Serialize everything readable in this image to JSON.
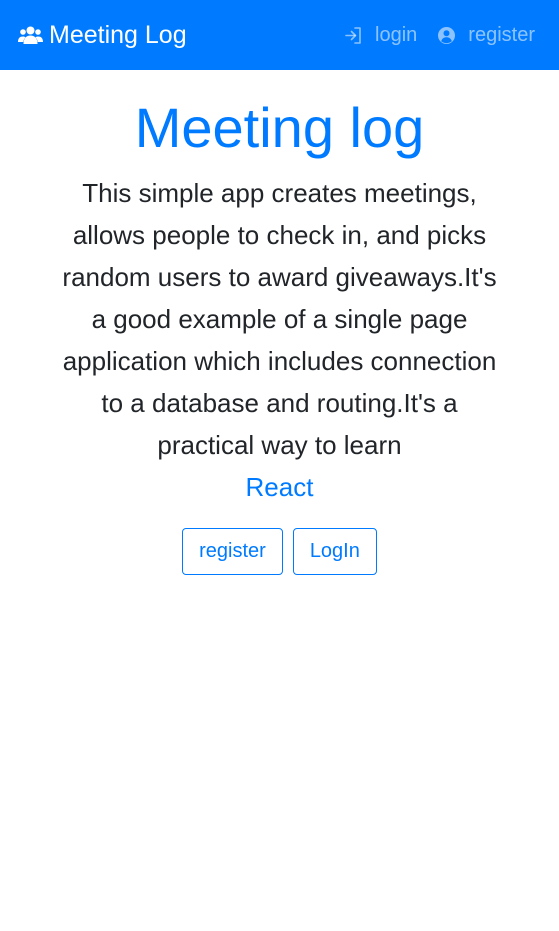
{
  "navbar": {
    "brand_label": "Meeting Log",
    "brand_icon": "users-icon",
    "links": [
      {
        "label": "login",
        "icon": "sign-in-icon"
      },
      {
        "label": "register",
        "icon": "user-circle-icon"
      }
    ],
    "background_color": "#007bff"
  },
  "hero": {
    "title": "Meeting log",
    "text": "This simple app creates meetings, allows people to check in, and picks random users to award giveaways.It's a good example of a single page application which includes connection to a database and routing.It's a practical way to learn",
    "link_label": "React",
    "buttons": {
      "register_label": "register",
      "login_label": "LogIn"
    }
  },
  "colors": {
    "primary": "#007bff",
    "text": "#212529"
  }
}
